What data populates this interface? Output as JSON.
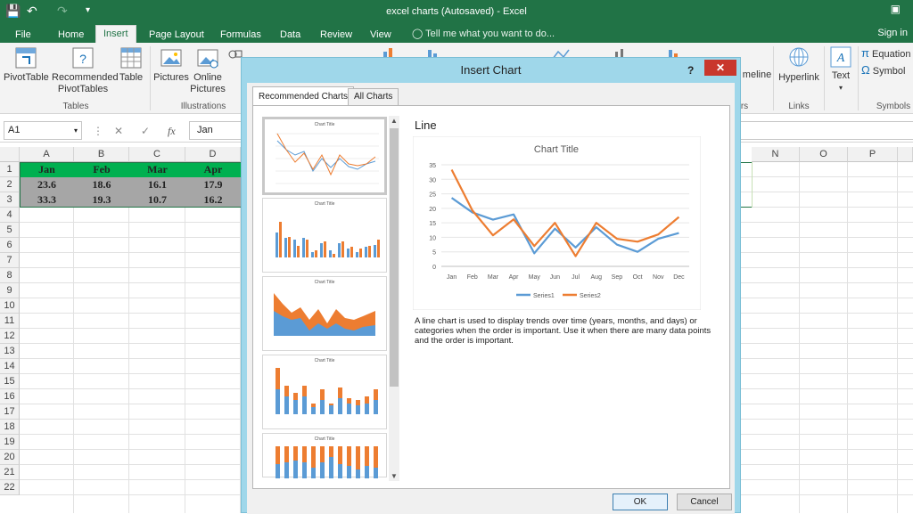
{
  "window": {
    "title": "excel charts (Autosaved) - Excel"
  },
  "ribbon": {
    "tabs": [
      "File",
      "Home",
      "Insert",
      "Page Layout",
      "Formulas",
      "Data",
      "Review",
      "View"
    ],
    "active_tab": "Insert",
    "tell_me": "Tell me what you want to do...",
    "sign_in": "Sign in",
    "tables": {
      "pivot": "PivotTable",
      "recommended_1": "Recommended",
      "recommended_2": "PivotTables",
      "table": "Table",
      "group": "Tables"
    },
    "illustrations": {
      "pictures": "Pictures",
      "online_1": "Online",
      "online_2": "Pictures",
      "group": "Illustrations"
    },
    "links": {
      "timeline": "meline",
      "hyperlink": "Hyperlink",
      "group": "Links"
    },
    "text": {
      "label": "Text"
    },
    "symbols": {
      "equation": "Equation",
      "symbol": "Symbol",
      "group": "Symbols",
      "pi": "π",
      "omega": "Ω"
    },
    "partial_group": "rs"
  },
  "formula_bar": {
    "name_box": "A1",
    "fx": "fx",
    "value": "Jan"
  },
  "sheet": {
    "columns": [
      "A",
      "B",
      "C",
      "D",
      "N",
      "O",
      "P"
    ],
    "rows": [
      "1",
      "2",
      "3",
      "4",
      "5",
      "6",
      "7",
      "8",
      "9",
      "10",
      "11",
      "12",
      "13",
      "14",
      "15",
      "16",
      "17",
      "18",
      "19",
      "20",
      "21",
      "22"
    ],
    "data": [
      [
        "Jan",
        "Feb",
        "Mar",
        "Apr"
      ],
      [
        "23.6",
        "18.6",
        "16.1",
        "17.9"
      ],
      [
        "33.3",
        "19.3",
        "10.7",
        "16.2"
      ]
    ],
    "header_fill": "#00b050",
    "data_fill": "#a6a6a6"
  },
  "dialog": {
    "title": "Insert Chart",
    "help": "?",
    "close": "✕",
    "tabs": [
      "Recommended Charts",
      "All Charts"
    ],
    "active_tab": "Recommended Charts",
    "thumb_title": "Chart Title",
    "selected_type": "Line",
    "description": "A line chart is used to display trends over time (years, months, and days) or categories when the order is important. Use it when there are many data points and the order is important.",
    "ok": "OK",
    "cancel": "Cancel"
  },
  "chart_data": {
    "type": "line",
    "title": "Chart Title",
    "categories": [
      "Jan",
      "Feb",
      "Mar",
      "Apr",
      "May",
      "Jun",
      "Jul",
      "Aug",
      "Sep",
      "Oct",
      "Nov",
      "Dec"
    ],
    "series": [
      {
        "name": "Series1",
        "color": "#5b9bd5",
        "values": [
          23.6,
          18.6,
          16.1,
          17.9,
          4.5,
          13.0,
          6.5,
          13.5,
          7.5,
          5.0,
          9.5,
          11.5
        ]
      },
      {
        "name": "Series2",
        "color": "#ed7d31",
        "values": [
          33.3,
          19.3,
          10.7,
          16.2,
          7.0,
          15.0,
          3.5,
          15.0,
          9.5,
          8.5,
          11.0,
          17.0
        ]
      }
    ],
    "ylim": [
      0,
      35
    ],
    "yticks": [
      0,
      5,
      10,
      15,
      20,
      25,
      30,
      35
    ],
    "grid": true,
    "legend": "bottom"
  }
}
